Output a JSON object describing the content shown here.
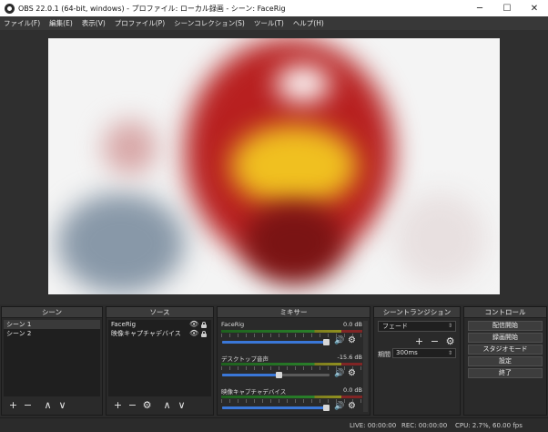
{
  "window": {
    "title": "OBS 22.0.1 (64-bit, windows) - プロファイル: ローカル録画 - シーン: FaceRig",
    "minimize": "─",
    "maximize": "☐",
    "close": "✕"
  },
  "menu": [
    "ファイル(F)",
    "編集(E)",
    "表示(V)",
    "プロファイル(P)",
    "シーンコレクション(S)",
    "ツール(T)",
    "ヘルプ(H)"
  ],
  "scenes": {
    "title": "シーン",
    "items": [
      "シーン 1",
      "シーン 2"
    ],
    "toolbar": [
      "+",
      "−",
      "∧",
      "∨"
    ]
  },
  "sources": {
    "title": "ソース",
    "items": [
      "FaceRig",
      "映像キャプチャデバイス"
    ],
    "toolbar": [
      "+",
      "−",
      "⚙",
      "∧",
      "∨"
    ]
  },
  "mixer": {
    "title": "ミキサー",
    "channels": [
      {
        "name": "FaceRig",
        "db": "0.0 dB",
        "volume": 1.0
      },
      {
        "name": "デスクトップ音声",
        "db": "-15.6 dB",
        "volume": 0.56
      },
      {
        "name": "映像キャプチャデバイス",
        "db": "0.0 dB",
        "volume": 1.0
      }
    ]
  },
  "transitions": {
    "title": "シーントランジション",
    "selected": "フェード",
    "duration_label": "期間",
    "duration_value": "300ms",
    "toolbar": [
      "+",
      "−",
      "⚙"
    ]
  },
  "controls": {
    "title": "コントロール",
    "buttons": [
      "配信開始",
      "録画開始",
      "スタジオモード",
      "設定",
      "終了"
    ]
  },
  "status": {
    "live": "LIVE: 00:00:00",
    "rec": "REC: 00:00:00",
    "cpu": "CPU: 2.7%, 60.00 fps"
  },
  "colors": {
    "accent_blue": "#3a77d8",
    "panel_bg": "#2a2a2a"
  }
}
